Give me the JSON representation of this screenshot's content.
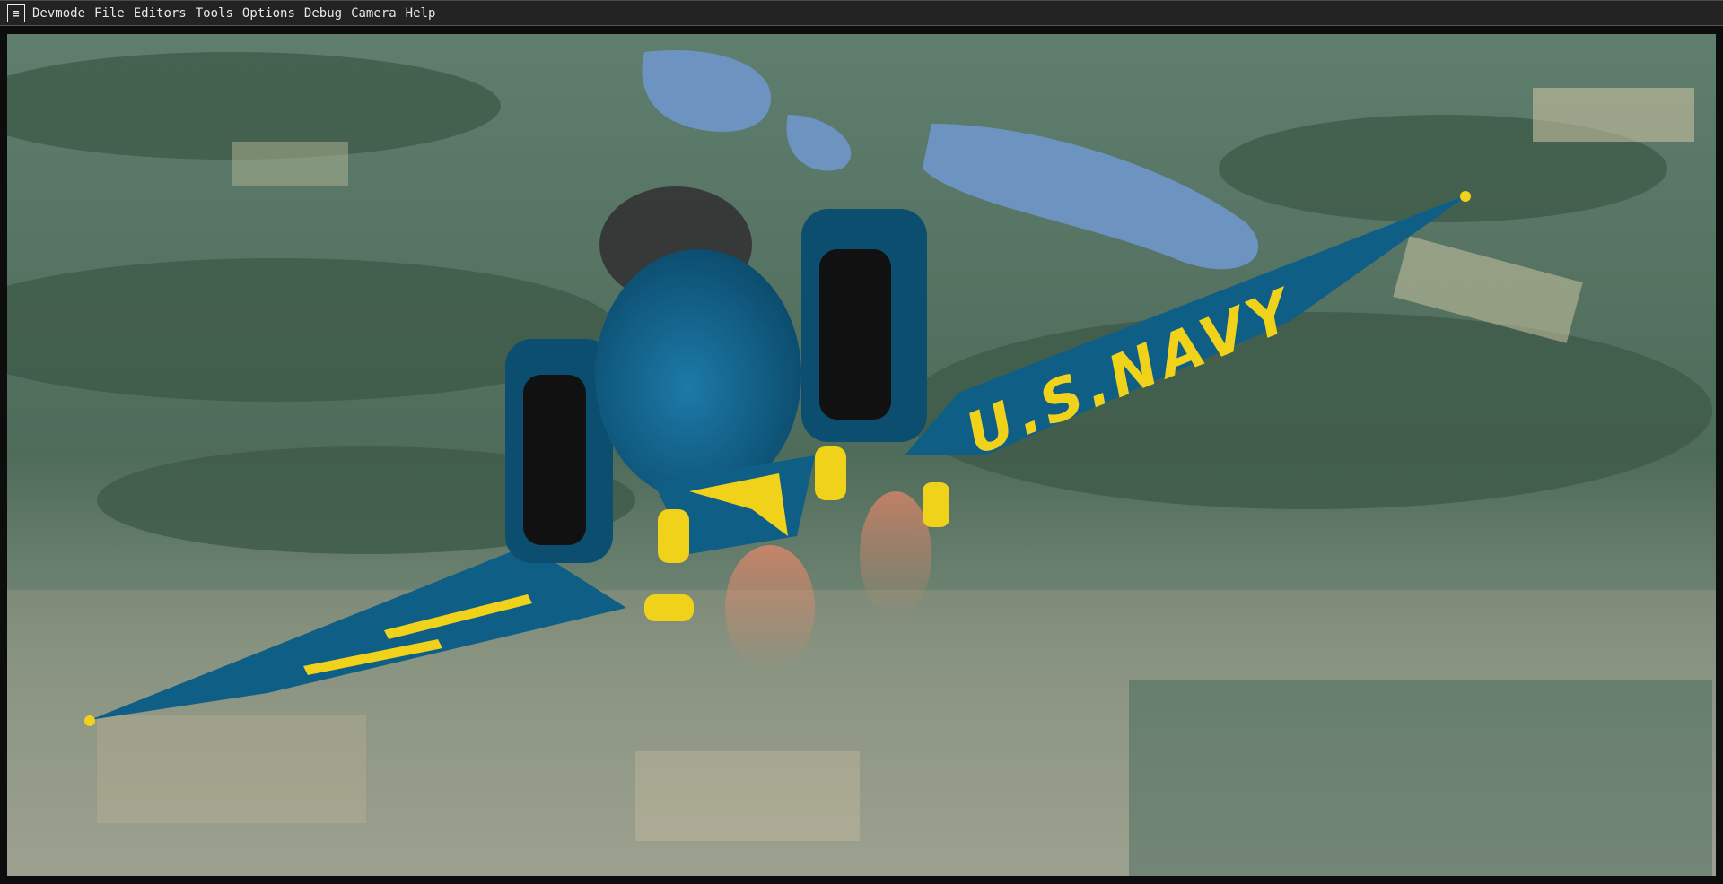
{
  "menubar": {
    "app_icon": "edit-note-icon",
    "items": [
      "Devmode",
      "File",
      "Editors",
      "Tools",
      "Options",
      "Debug",
      "Camera",
      "Help"
    ]
  },
  "scene": {
    "aircraft_marking": "U.S.NAVY",
    "colors": {
      "aircraft_blue": "#0f5e86",
      "aircraft_yellow": "#f1d21a",
      "terrain": "#6f8a86",
      "water": "#6d93c1"
    }
  }
}
